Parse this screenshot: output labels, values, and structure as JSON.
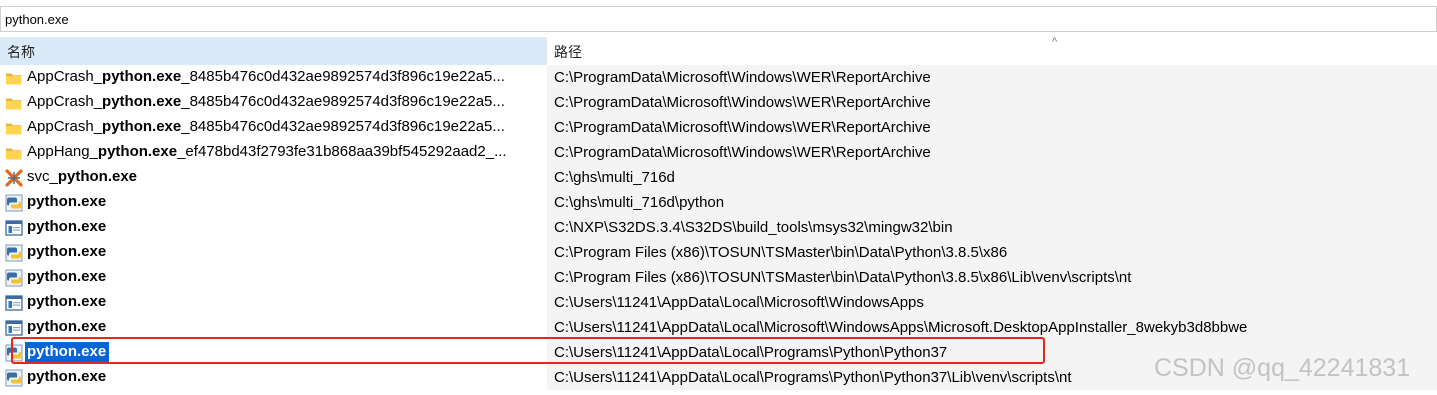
{
  "search": {
    "value": "python.exe"
  },
  "columns": {
    "name": "名称",
    "path": "路径",
    "sort_indicator": "^"
  },
  "rows": [
    {
      "icon": "folder-icon",
      "prefix": "AppCrash_",
      "bold": "python.exe",
      "suffix": "_8485b476c0d432ae9892574d3f896c19e22a5...",
      "path": "C:\\ProgramData\\Microsoft\\Windows\\WER\\ReportArchive",
      "selected": false
    },
    {
      "icon": "folder-icon",
      "prefix": "AppCrash_",
      "bold": "python.exe",
      "suffix": "_8485b476c0d432ae9892574d3f896c19e22a5...",
      "path": "C:\\ProgramData\\Microsoft\\Windows\\WER\\ReportArchive",
      "selected": false
    },
    {
      "icon": "folder-icon",
      "prefix": "AppCrash_",
      "bold": "python.exe",
      "suffix": "_8485b476c0d432ae9892574d3f896c19e22a5...",
      "path": "C:\\ProgramData\\Microsoft\\Windows\\WER\\ReportArchive",
      "selected": false
    },
    {
      "icon": "folder-icon",
      "prefix": "AppHang_",
      "bold": "python.exe",
      "suffix": "_ef478bd43f2793fe31b868aa39bf545292aad2_...",
      "path": "C:\\ProgramData\\Microsoft\\Windows\\WER\\ReportArchive",
      "selected": false
    },
    {
      "icon": "service-executable-icon",
      "prefix": "svc_",
      "bold": "python.exe",
      "suffix": "",
      "path": "C:\\ghs\\multi_716d",
      "selected": false
    },
    {
      "icon": "python-icon",
      "prefix": "",
      "bold": "python.exe",
      "suffix": "",
      "path": "C:\\ghs\\multi_716d\\python",
      "selected": false
    },
    {
      "icon": "application-window-icon",
      "prefix": "",
      "bold": "python.exe",
      "suffix": "",
      "path": "C:\\NXP\\S32DS.3.4\\S32DS\\build_tools\\msys32\\mingw32\\bin",
      "selected": false
    },
    {
      "icon": "python-icon",
      "prefix": "",
      "bold": "python.exe",
      "suffix": "",
      "path": "C:\\Program Files (x86)\\TOSUN\\TSMaster\\bin\\Data\\Python\\3.8.5\\x86",
      "selected": false
    },
    {
      "icon": "python-icon",
      "prefix": "",
      "bold": "python.exe",
      "suffix": "",
      "path": "C:\\Program Files (x86)\\TOSUN\\TSMaster\\bin\\Data\\Python\\3.8.5\\x86\\Lib\\venv\\scripts\\nt",
      "selected": false
    },
    {
      "icon": "application-window-icon",
      "prefix": "",
      "bold": "python.exe",
      "suffix": "",
      "path": "C:\\Users\\11241\\AppData\\Local\\Microsoft\\WindowsApps",
      "selected": false
    },
    {
      "icon": "application-window-icon",
      "prefix": "",
      "bold": "python.exe",
      "suffix": "",
      "path": "C:\\Users\\11241\\AppData\\Local\\Microsoft\\WindowsApps\\Microsoft.DesktopAppInstaller_8wekyb3d8bbwe",
      "selected": false
    },
    {
      "icon": "python-icon",
      "prefix": "",
      "bold": "python.exe",
      "suffix": "",
      "path": "C:\\Users\\11241\\AppData\\Local\\Programs\\Python\\Python37",
      "selected": true
    },
    {
      "icon": "python-icon",
      "prefix": "",
      "bold": "python.exe",
      "suffix": "",
      "path": "C:\\Users\\11241\\AppData\\Local\\Programs\\Python\\Python37\\Lib\\venv\\scripts\\nt",
      "selected": false
    }
  ],
  "colors": {
    "selection": "#0a64d6",
    "annotation": "#e8251f",
    "header_name_bg": "#dbeaf8"
  },
  "watermark": "CSDN @qq_42241831"
}
